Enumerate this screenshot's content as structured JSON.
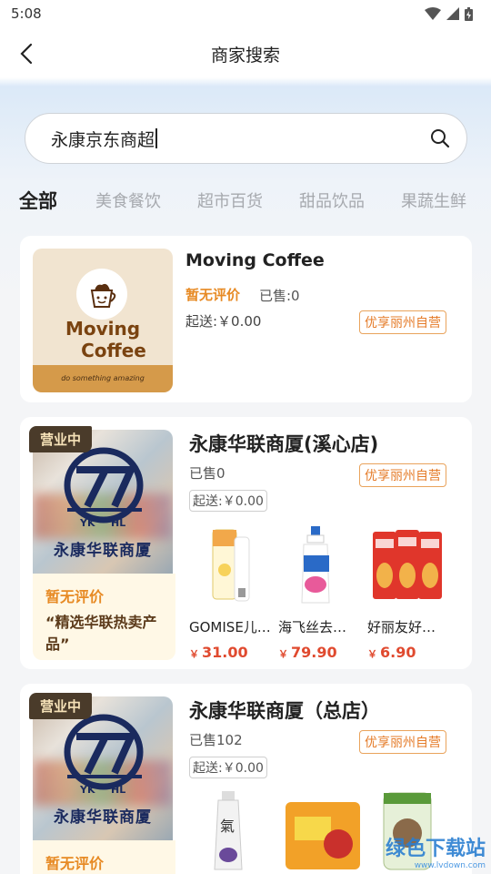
{
  "status_bar": {
    "time": "5:08"
  },
  "nav": {
    "title": "商家搜索"
  },
  "search": {
    "value": "永康京东商超"
  },
  "tabs": [
    "全部",
    "美食餐饮",
    "超市百货",
    "甜品饮品",
    "果蔬生鲜"
  ],
  "colors": {
    "accent_orange": "#e78a24",
    "price_red": "#e04a2f",
    "badge_brown": "#4a3b2a"
  },
  "shops": [
    {
      "name": "Moving Coffee",
      "logo_words": [
        "Moving",
        "Coffee"
      ],
      "logo_tagline": "do something amazing",
      "rating": "暂无评价",
      "sold": "已售:0",
      "min_price": "起送:￥0.00",
      "tag": "优享丽州自营"
    },
    {
      "name": "永康华联商厦(溪心店)",
      "status": "营业中",
      "logo_text": "永康华联商厦",
      "rating": "暂无评价",
      "promo": "“精选华联热卖产品”",
      "sold": "已售0",
      "min_price": "起送:￥0.00",
      "tag": "优享丽州自营",
      "products": [
        {
          "name": "GOMISE儿…",
          "price": "31.00",
          "icon": "toothpaste-icon"
        },
        {
          "name": "海飞丝去…",
          "price": "79.90",
          "icon": "shampoo-icon"
        },
        {
          "name": "好丽友好…",
          "price": "6.90",
          "icon": "chips-icon"
        }
      ]
    },
    {
      "name": "永康华联商厦（总店）",
      "status": "营业中",
      "logo_text": "永康华联商厦",
      "rating": "暂无评价",
      "sold": "已售102",
      "min_price": "起送:￥0.00",
      "tag": "优享丽州自营"
    }
  ],
  "currency": "￥",
  "watermark": {
    "text": "绿色下载站",
    "url": "www.lvdown.com"
  }
}
